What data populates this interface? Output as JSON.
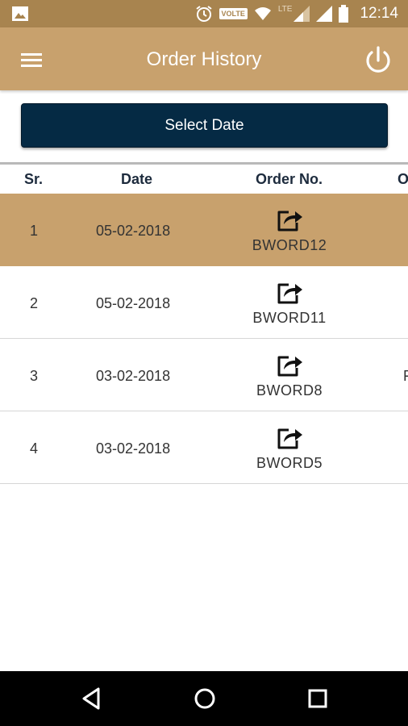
{
  "status_bar": {
    "time": "12:14",
    "volte": "VOLTE",
    "network": "LTE"
  },
  "app_bar": {
    "title": "Order History",
    "menu_icon": "hamburger-menu-icon",
    "power_icon": "power-icon"
  },
  "select_date": {
    "label": "Select Date"
  },
  "table": {
    "headers": {
      "sr": "Sr.",
      "date": "Date",
      "order_no": "Order No.",
      "other": "O"
    },
    "rows": [
      {
        "sr": "1",
        "date": "05-02-2018",
        "order_no": "BWORD12",
        "extra": "",
        "highlighted": true
      },
      {
        "sr": "2",
        "date": "05-02-2018",
        "order_no": "BWORD11",
        "extra": ""
      },
      {
        "sr": "3",
        "date": "03-02-2018",
        "order_no": "BWORD8",
        "extra": "F"
      },
      {
        "sr": "4",
        "date": "03-02-2018",
        "order_no": "BWORD5",
        "extra": ""
      }
    ]
  },
  "colors": {
    "status_bar": "#a8844f",
    "app_bar": "#c8a16d",
    "button": "#052a44",
    "highlight_row": "#c8a16d"
  }
}
